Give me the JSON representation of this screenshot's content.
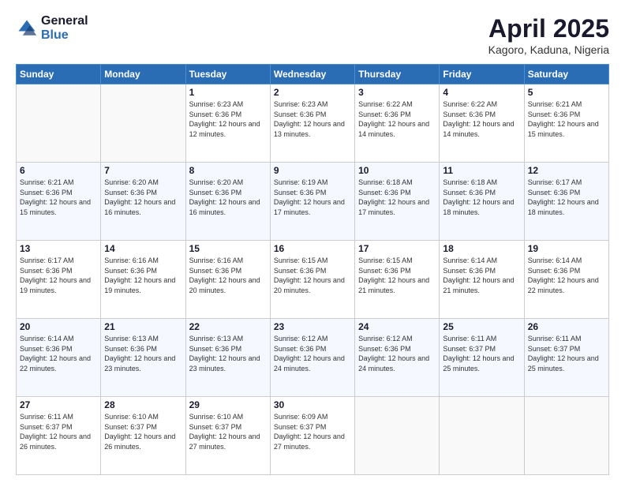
{
  "header": {
    "logo_general": "General",
    "logo_blue": "Blue",
    "month": "April 2025",
    "location": "Kagoro, Kaduna, Nigeria"
  },
  "days_of_week": [
    "Sunday",
    "Monday",
    "Tuesday",
    "Wednesday",
    "Thursday",
    "Friday",
    "Saturday"
  ],
  "weeks": [
    [
      {
        "day": "",
        "info": ""
      },
      {
        "day": "",
        "info": ""
      },
      {
        "day": "1",
        "info": "Sunrise: 6:23 AM\nSunset: 6:36 PM\nDaylight: 12 hours and 12 minutes."
      },
      {
        "day": "2",
        "info": "Sunrise: 6:23 AM\nSunset: 6:36 PM\nDaylight: 12 hours and 13 minutes."
      },
      {
        "day": "3",
        "info": "Sunrise: 6:22 AM\nSunset: 6:36 PM\nDaylight: 12 hours and 14 minutes."
      },
      {
        "day": "4",
        "info": "Sunrise: 6:22 AM\nSunset: 6:36 PM\nDaylight: 12 hours and 14 minutes."
      },
      {
        "day": "5",
        "info": "Sunrise: 6:21 AM\nSunset: 6:36 PM\nDaylight: 12 hours and 15 minutes."
      }
    ],
    [
      {
        "day": "6",
        "info": "Sunrise: 6:21 AM\nSunset: 6:36 PM\nDaylight: 12 hours and 15 minutes."
      },
      {
        "day": "7",
        "info": "Sunrise: 6:20 AM\nSunset: 6:36 PM\nDaylight: 12 hours and 16 minutes."
      },
      {
        "day": "8",
        "info": "Sunrise: 6:20 AM\nSunset: 6:36 PM\nDaylight: 12 hours and 16 minutes."
      },
      {
        "day": "9",
        "info": "Sunrise: 6:19 AM\nSunset: 6:36 PM\nDaylight: 12 hours and 17 minutes."
      },
      {
        "day": "10",
        "info": "Sunrise: 6:18 AM\nSunset: 6:36 PM\nDaylight: 12 hours and 17 minutes."
      },
      {
        "day": "11",
        "info": "Sunrise: 6:18 AM\nSunset: 6:36 PM\nDaylight: 12 hours and 18 minutes."
      },
      {
        "day": "12",
        "info": "Sunrise: 6:17 AM\nSunset: 6:36 PM\nDaylight: 12 hours and 18 minutes."
      }
    ],
    [
      {
        "day": "13",
        "info": "Sunrise: 6:17 AM\nSunset: 6:36 PM\nDaylight: 12 hours and 19 minutes."
      },
      {
        "day": "14",
        "info": "Sunrise: 6:16 AM\nSunset: 6:36 PM\nDaylight: 12 hours and 19 minutes."
      },
      {
        "day": "15",
        "info": "Sunrise: 6:16 AM\nSunset: 6:36 PM\nDaylight: 12 hours and 20 minutes."
      },
      {
        "day": "16",
        "info": "Sunrise: 6:15 AM\nSunset: 6:36 PM\nDaylight: 12 hours and 20 minutes."
      },
      {
        "day": "17",
        "info": "Sunrise: 6:15 AM\nSunset: 6:36 PM\nDaylight: 12 hours and 21 minutes."
      },
      {
        "day": "18",
        "info": "Sunrise: 6:14 AM\nSunset: 6:36 PM\nDaylight: 12 hours and 21 minutes."
      },
      {
        "day": "19",
        "info": "Sunrise: 6:14 AM\nSunset: 6:36 PM\nDaylight: 12 hours and 22 minutes."
      }
    ],
    [
      {
        "day": "20",
        "info": "Sunrise: 6:14 AM\nSunset: 6:36 PM\nDaylight: 12 hours and 22 minutes."
      },
      {
        "day": "21",
        "info": "Sunrise: 6:13 AM\nSunset: 6:36 PM\nDaylight: 12 hours and 23 minutes."
      },
      {
        "day": "22",
        "info": "Sunrise: 6:13 AM\nSunset: 6:36 PM\nDaylight: 12 hours and 23 minutes."
      },
      {
        "day": "23",
        "info": "Sunrise: 6:12 AM\nSunset: 6:36 PM\nDaylight: 12 hours and 24 minutes."
      },
      {
        "day": "24",
        "info": "Sunrise: 6:12 AM\nSunset: 6:36 PM\nDaylight: 12 hours and 24 minutes."
      },
      {
        "day": "25",
        "info": "Sunrise: 6:11 AM\nSunset: 6:37 PM\nDaylight: 12 hours and 25 minutes."
      },
      {
        "day": "26",
        "info": "Sunrise: 6:11 AM\nSunset: 6:37 PM\nDaylight: 12 hours and 25 minutes."
      }
    ],
    [
      {
        "day": "27",
        "info": "Sunrise: 6:11 AM\nSunset: 6:37 PM\nDaylight: 12 hours and 26 minutes."
      },
      {
        "day": "28",
        "info": "Sunrise: 6:10 AM\nSunset: 6:37 PM\nDaylight: 12 hours and 26 minutes."
      },
      {
        "day": "29",
        "info": "Sunrise: 6:10 AM\nSunset: 6:37 PM\nDaylight: 12 hours and 27 minutes."
      },
      {
        "day": "30",
        "info": "Sunrise: 6:09 AM\nSunset: 6:37 PM\nDaylight: 12 hours and 27 minutes."
      },
      {
        "day": "",
        "info": ""
      },
      {
        "day": "",
        "info": ""
      },
      {
        "day": "",
        "info": ""
      }
    ]
  ]
}
